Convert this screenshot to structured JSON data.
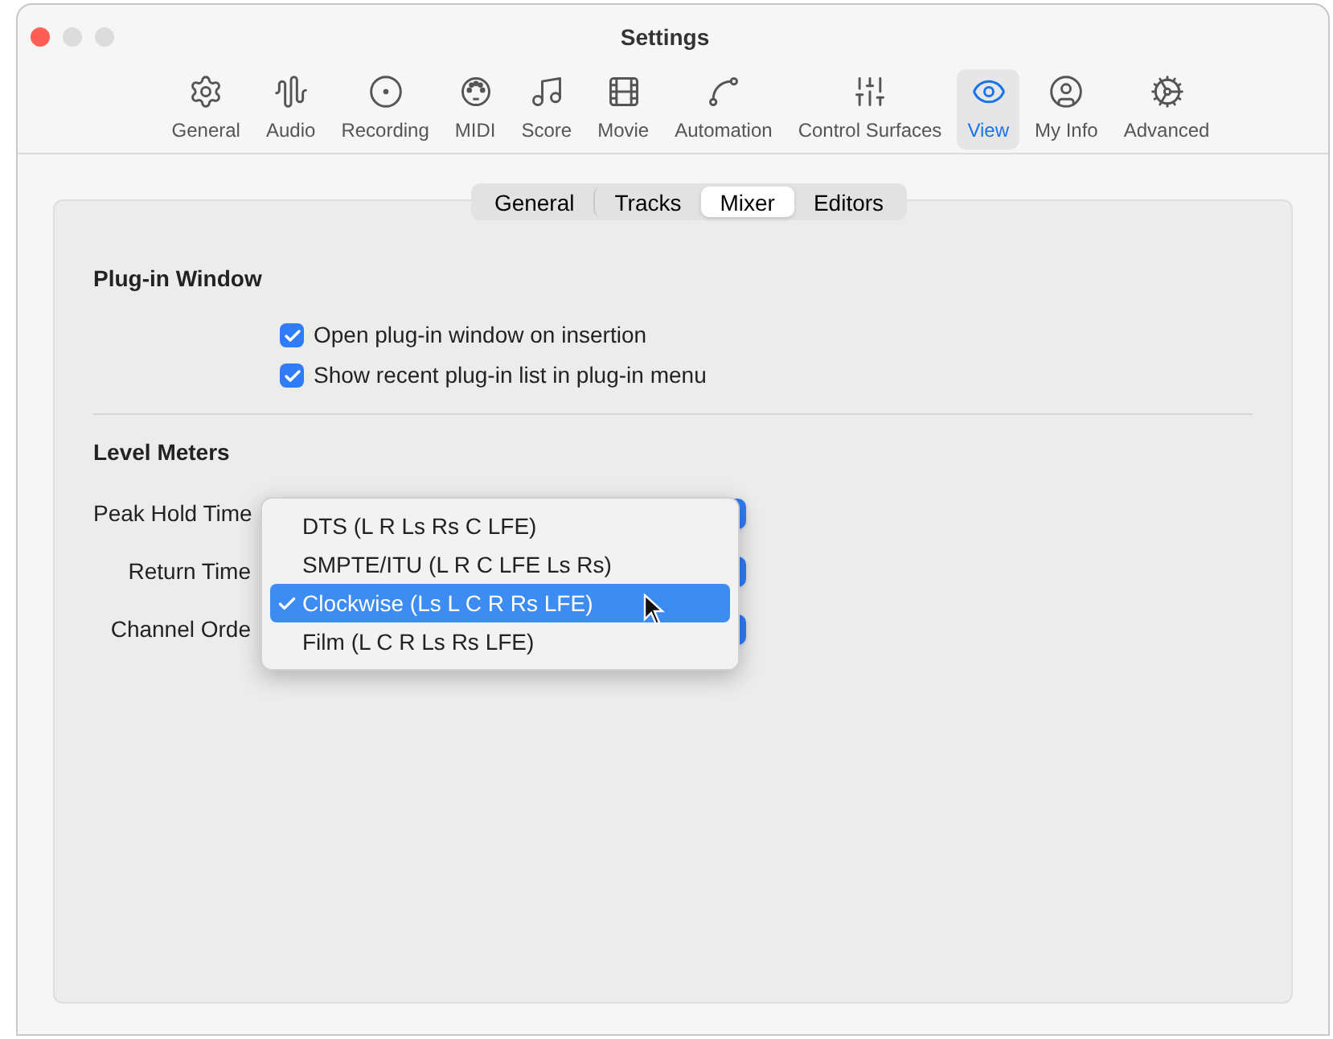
{
  "window": {
    "title": "Settings"
  },
  "toolbar": [
    {
      "label": "General",
      "kind": "general",
      "selected": false
    },
    {
      "label": "Audio",
      "kind": "audio",
      "selected": false
    },
    {
      "label": "Recording",
      "kind": "recording",
      "selected": false
    },
    {
      "label": "MIDI",
      "kind": "midi",
      "selected": false
    },
    {
      "label": "Score",
      "kind": "score",
      "selected": false
    },
    {
      "label": "Movie",
      "kind": "movie",
      "selected": false
    },
    {
      "label": "Automation",
      "kind": "automation",
      "selected": false
    },
    {
      "label": "Control Surfaces",
      "kind": "surfaces",
      "selected": false
    },
    {
      "label": "View",
      "kind": "view",
      "selected": true
    },
    {
      "label": "My Info",
      "kind": "info",
      "selected": false
    },
    {
      "label": "Advanced",
      "kind": "advanced",
      "selected": false
    }
  ],
  "tabs": [
    {
      "label": "General",
      "selected": false
    },
    {
      "label": "Tracks",
      "selected": false
    },
    {
      "label": "Mixer",
      "selected": true
    },
    {
      "label": "Editors",
      "selected": false
    }
  ],
  "plugin_window": {
    "heading": "Plug-in Window",
    "options": [
      {
        "label": "Open plug-in window on insertion",
        "checked": true
      },
      {
        "label": "Show recent plug-in list in plug-in menu",
        "checked": true
      }
    ]
  },
  "level_meters": {
    "heading": "Level Meters",
    "fields": [
      {
        "label": "Peak Hold Time"
      },
      {
        "label": "Return Time"
      },
      {
        "label": "Channel Orde"
      }
    ]
  },
  "menu": [
    {
      "label": "DTS (L R Ls Rs C LFE)",
      "selected": false
    },
    {
      "label": "SMPTE/ITU (L R C LFE Ls Rs)",
      "selected": false
    },
    {
      "label": "Clockwise (Ls L C R Rs LFE)",
      "selected": true
    },
    {
      "label": "Film (L C R Ls Rs LFE)",
      "selected": false
    }
  ]
}
